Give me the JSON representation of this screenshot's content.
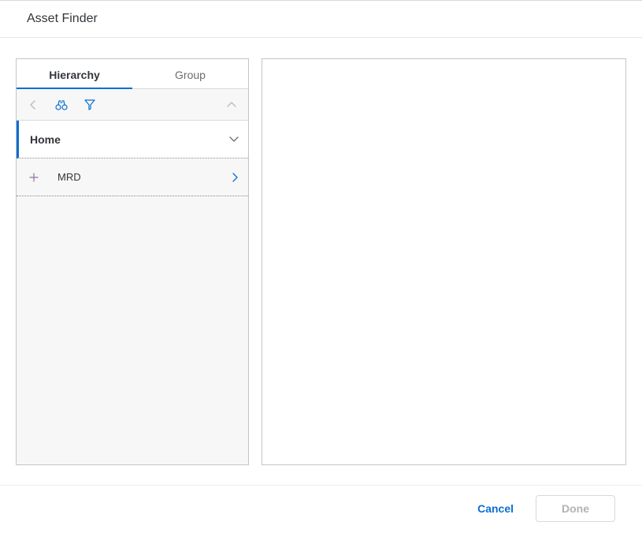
{
  "header": {
    "title": "Asset Finder"
  },
  "tabs": {
    "hierarchy": "Hierarchy",
    "group": "Group"
  },
  "tree": {
    "home": "Home",
    "children": [
      {
        "label": "MRD"
      }
    ]
  },
  "footer": {
    "cancel": "Cancel",
    "done": "Done"
  }
}
